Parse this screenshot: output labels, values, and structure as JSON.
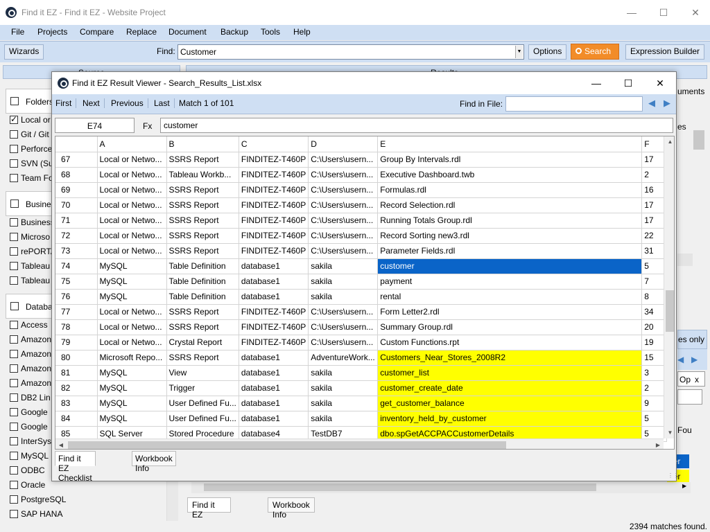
{
  "window": {
    "title": "Find it EZ - Find it EZ - Website Project"
  },
  "menu": [
    "File",
    "Projects",
    "Compare",
    "Replace",
    "Document",
    "Backup",
    "Tools",
    "Help"
  ],
  "toolbar": {
    "wizards_label": "Wizards",
    "find_label": "Find:",
    "find_value": "Customer",
    "options_label": "Options",
    "search_label": "Search",
    "expression_builder_label": "Expression Builder"
  },
  "left_pane": {
    "header": "Source",
    "groups": [
      {
        "label": "Folders",
        "items": [
          {
            "label": "Local or",
            "checked": true
          },
          {
            "label": "Git / Git",
            "checked": false
          },
          {
            "label": "Perforce",
            "checked": false
          },
          {
            "label": "SVN (Su",
            "checked": false
          },
          {
            "label": "Team Fo",
            "checked": false
          }
        ]
      },
      {
        "label": "Busines",
        "items": [
          {
            "label": "Business",
            "checked": false
          },
          {
            "label": "Microso",
            "checked": false
          },
          {
            "label": "rePORTA",
            "checked": false
          },
          {
            "label": "Tableau",
            "checked": false
          },
          {
            "label": "Tableau",
            "checked": false
          }
        ]
      },
      {
        "label": "Databa",
        "items": [
          {
            "label": "Access",
            "checked": false
          },
          {
            "label": "Amazon",
            "checked": false
          },
          {
            "label": "Amazon",
            "checked": false
          },
          {
            "label": "Amazon",
            "checked": false
          },
          {
            "label": "Amazon",
            "checked": false
          },
          {
            "label": "DB2 Lin",
            "checked": false
          },
          {
            "label": "Google",
            "checked": false
          },
          {
            "label": "Google",
            "checked": false
          },
          {
            "label": "InterSys",
            "checked": false
          },
          {
            "label": "MySQL",
            "checked": false
          },
          {
            "label": "ODBC",
            "checked": false
          },
          {
            "label": "Oracle",
            "checked": false
          },
          {
            "label": "PostgreSQL",
            "checked": false
          },
          {
            "label": "SAP HANA",
            "checked": false
          }
        ]
      }
    ]
  },
  "right_pane": {
    "header": "Results",
    "fragments": {
      "uments": "uments",
      "es": "es",
      "es_only": "es only",
      "op": "Op",
      "x": "x",
      "fou": "Fou",
      "ner1": "ner",
      "ner2": "ner"
    }
  },
  "back_tabs": [
    "Find it EZ Checklist",
    "Workbook Info"
  ],
  "status": {
    "matches": "2394 matches found."
  },
  "dialog": {
    "title": "Find it EZ Result Viewer - Search_Results_List.xlsx",
    "nav": [
      "First",
      "Next",
      "Previous",
      "Last"
    ],
    "match_label": "Match 1 of 101",
    "find_in_file_label": "Find in File:",
    "find_in_file_value": "",
    "cell_ref": "E74",
    "fx_label": "Fx",
    "formula": "customer",
    "columns": [
      "",
      "A",
      "B",
      "C",
      "D",
      "E",
      "F"
    ],
    "rows": [
      {
        "n": "67",
        "a": "Local or Netwo...",
        "b": "SSRS Report",
        "c": "FINDITEZ-T460P",
        "d": "C:\\Users\\usern...",
        "e": "Group By Intervals.rdl",
        "f": "17",
        "hl": ""
      },
      {
        "n": "68",
        "a": "Local or Netwo...",
        "b": "Tableau Workb...",
        "c": "FINDITEZ-T460P",
        "d": "C:\\Users\\usern...",
        "e": "Executive Dashboard.twb",
        "f": "2",
        "hl": ""
      },
      {
        "n": "69",
        "a": "Local or Netwo...",
        "b": "SSRS Report",
        "c": "FINDITEZ-T460P",
        "d": "C:\\Users\\usern...",
        "e": "Formulas.rdl",
        "f": "16",
        "hl": ""
      },
      {
        "n": "70",
        "a": "Local or Netwo...",
        "b": "SSRS Report",
        "c": "FINDITEZ-T460P",
        "d": "C:\\Users\\usern...",
        "e": "Record Selection.rdl",
        "f": "17",
        "hl": ""
      },
      {
        "n": "71",
        "a": "Local or Netwo...",
        "b": "SSRS Report",
        "c": "FINDITEZ-T460P",
        "d": "C:\\Users\\usern...",
        "e": "Running Totals Group.rdl",
        "f": "17",
        "hl": ""
      },
      {
        "n": "72",
        "a": "Local or Netwo...",
        "b": "SSRS Report",
        "c": "FINDITEZ-T460P",
        "d": "C:\\Users\\usern...",
        "e": "Record Sorting new3.rdl",
        "f": "22",
        "hl": ""
      },
      {
        "n": "73",
        "a": "Local or Netwo...",
        "b": "SSRS Report",
        "c": "FINDITEZ-T460P",
        "d": "C:\\Users\\usern...",
        "e": "Parameter Fields.rdl",
        "f": "31",
        "hl": ""
      },
      {
        "n": "74",
        "a": "MySQL",
        "b": "Table Definition",
        "c": "database1",
        "d": "sakila",
        "e": "customer",
        "f": "5",
        "hl": "blue"
      },
      {
        "n": "75",
        "a": "MySQL",
        "b": "Table Definition",
        "c": "database1",
        "d": "sakila",
        "e": "payment",
        "f": "7",
        "hl": ""
      },
      {
        "n": "76",
        "a": "MySQL",
        "b": "Table Definition",
        "c": "database1",
        "d": "sakila",
        "e": "rental",
        "f": "8",
        "hl": ""
      },
      {
        "n": "77",
        "a": "Local or Netwo...",
        "b": "SSRS Report",
        "c": "FINDITEZ-T460P",
        "d": "C:\\Users\\usern...",
        "e": "Form Letter2.rdl",
        "f": "34",
        "hl": ""
      },
      {
        "n": "78",
        "a": "Local or Netwo...",
        "b": "SSRS Report",
        "c": "FINDITEZ-T460P",
        "d": "C:\\Users\\usern...",
        "e": "Summary Group.rdl",
        "f": "20",
        "hl": ""
      },
      {
        "n": "79",
        "a": "Local or Netwo...",
        "b": "Crystal Report",
        "c": "FINDITEZ-T460P",
        "d": "C:\\Users\\usern...",
        "e": "Custom Functions.rpt",
        "f": "19",
        "hl": ""
      },
      {
        "n": "80",
        "a": "Microsoft Repo...",
        "b": "SSRS Report",
        "c": "database1",
        "d": "AdventureWork...",
        "e": "Customers_Near_Stores_2008R2",
        "f": "15",
        "hl": "yellow"
      },
      {
        "n": "81",
        "a": "MySQL",
        "b": "View",
        "c": "database1",
        "d": "sakila",
        "e": "customer_list",
        "f": "3",
        "hl": "yellow"
      },
      {
        "n": "82",
        "a": "MySQL",
        "b": "Trigger",
        "c": "database1",
        "d": "sakila",
        "e": "customer_create_date",
        "f": "2",
        "hl": "yellow"
      },
      {
        "n": "83",
        "a": "MySQL",
        "b": "User Defined Fu...",
        "c": "database1",
        "d": "sakila",
        "e": "get_customer_balance",
        "f": "9",
        "hl": "yellow"
      },
      {
        "n": "84",
        "a": "MySQL",
        "b": "User Defined Fu...",
        "c": "database1",
        "d": "sakila",
        "e": "inventory_held_by_customer",
        "f": "5",
        "hl": "yellow"
      },
      {
        "n": "85",
        "a": "SQL Server",
        "b": "Stored Procedure",
        "c": "database4",
        "d": "TestDB7",
        "e": "dbo.spGetACCPACCustomerDetails",
        "f": "5",
        "hl": "yellow"
      }
    ],
    "tabs": [
      "Find it EZ Checklist",
      "Workbook Info"
    ]
  },
  "colors": {
    "menu_bg": "#cfdff3",
    "search_button": "#f28c28",
    "highlight_yellow": "#ffff00",
    "selected_blue": "#0a64c8"
  }
}
